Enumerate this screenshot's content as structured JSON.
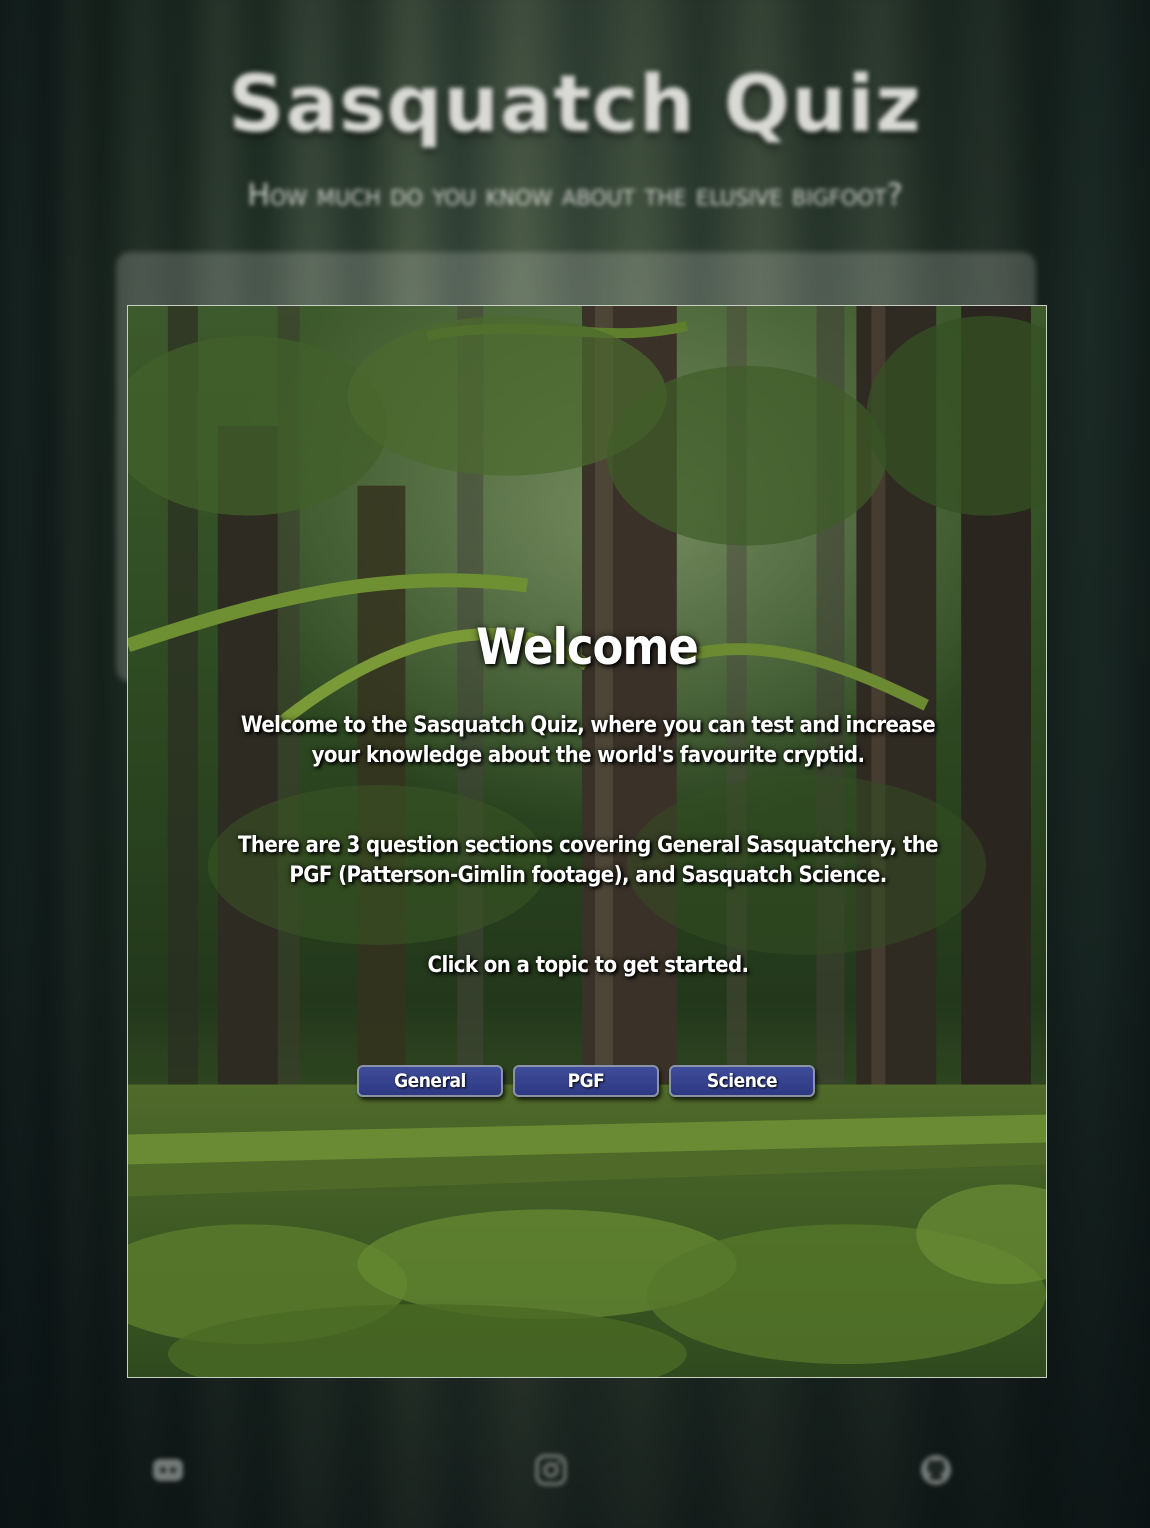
{
  "header": {
    "title": "Sasquatch Quiz",
    "subtitle": "How much do you know about the elusive bigfoot?"
  },
  "modal": {
    "title": "Welcome",
    "paragraphs": [
      "Welcome to the Sasquatch Quiz, where you can test and increase your knowledge about the world's favourite cryptid.",
      "There are 3 question sections covering General Sasquatchery, the PGF (Patterson-Gimlin footage), and Sasquatch Science.",
      "Click on a topic to get started."
    ],
    "topics": [
      {
        "label": "General"
      },
      {
        "label": "PGF"
      },
      {
        "label": "Science"
      }
    ]
  },
  "footer": {
    "icons": [
      "discord-icon",
      "instagram-icon",
      "github-icon"
    ]
  },
  "colors": {
    "button_bg": "#34408c",
    "button_border": "#8d93a6",
    "text": "#ffffff",
    "modal_border": "#c9cfc4"
  }
}
